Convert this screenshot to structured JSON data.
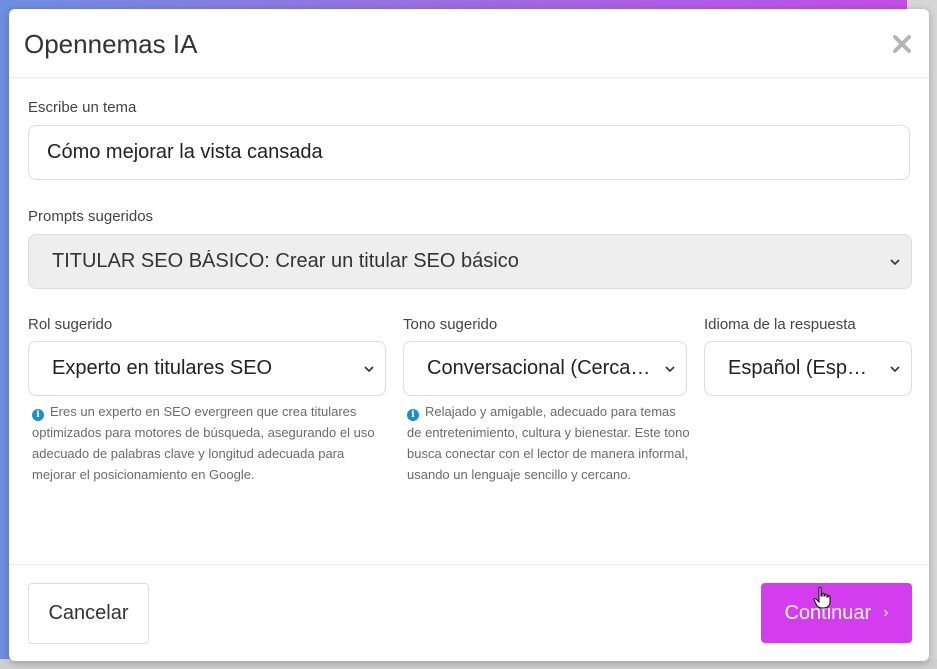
{
  "modal": {
    "title": "Opennemas IA",
    "close_icon": "close-icon"
  },
  "topic": {
    "label": "Escribe un tema",
    "value": "Cómo mejorar la vista cansada"
  },
  "prompts": {
    "label": "Prompts sugeridos",
    "selected": "TITULAR SEO BÁSICO: Crear un titular SEO básico"
  },
  "role": {
    "label": "Rol sugerido",
    "selected": "Experto en titulares SEO",
    "help": "Eres un experto en SEO evergreen que crea titulares optimizados para motores de búsqueda, asegurando el uso adecuado de palabras clave y longitud adecuada para mejorar el posicionamiento en Google."
  },
  "tone": {
    "label": "Tono sugerido",
    "selected": "Conversacional (Cercano)",
    "help": "Relajado y amigable, adecuado para temas de entretenimiento, cultura y bienestar. Este tono busca conectar con el lector de manera informal, usando un lenguaje sencillo y cercano."
  },
  "language": {
    "label": "Idioma de la respuesta",
    "selected": "Español (España)"
  },
  "footer": {
    "cancel_label": "Cancelar",
    "continue_label": "Continuar",
    "continue_icon": "chevron-right-icon"
  },
  "colors": {
    "accent": "#d43cf0",
    "info": "#1a8fd0"
  }
}
